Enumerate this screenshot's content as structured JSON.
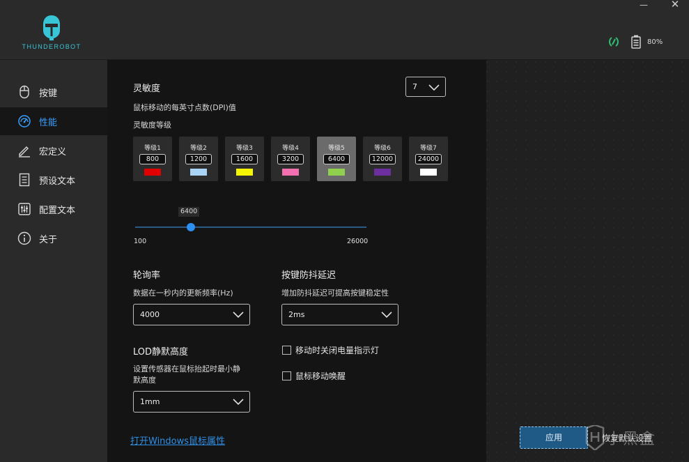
{
  "app": {
    "brand": "THUNDEROBOT",
    "battery": "80%",
    "window_min": "—",
    "window_close": "✕"
  },
  "sidebar": {
    "items": [
      {
        "label": "按键",
        "icon": "mouse-icon",
        "active": false
      },
      {
        "label": "性能",
        "icon": "gauge-icon",
        "active": true
      },
      {
        "label": "宏定义",
        "icon": "pen-icon",
        "active": false
      },
      {
        "label": "预设文本",
        "icon": "document-icon",
        "active": false
      },
      {
        "label": "配置文本",
        "icon": "sliders-icon",
        "active": false
      },
      {
        "label": "关于",
        "icon": "info-icon",
        "active": false
      }
    ]
  },
  "sensitivity": {
    "title": "灵敏度",
    "desc": "鼠标移动的每英寸点数(DPI)值",
    "levels_label": "灵敏度等级",
    "level_count": "7",
    "levels": [
      {
        "name": "等级1",
        "value": "800",
        "color": "#e00000"
      },
      {
        "name": "等级2",
        "value": "1200",
        "color": "#a9d4f5"
      },
      {
        "name": "等级3",
        "value": "1600",
        "color": "#f5f500"
      },
      {
        "name": "等级4",
        "value": "3200",
        "color": "#f36fb0"
      },
      {
        "name": "等级5",
        "value": "6400",
        "color": "#8fd14f"
      },
      {
        "name": "等级6",
        "value": "12000",
        "color": "#6b2fa0"
      },
      {
        "name": "等级7",
        "value": "24000",
        "color": "#ffffff"
      }
    ],
    "active_level": 5,
    "slider": {
      "value": "6400",
      "min": "100",
      "max": "26000",
      "fraction": 0.24
    }
  },
  "polling": {
    "title": "轮询率",
    "desc": "数据在一秒内的更新频率(Hz)",
    "value": "4000"
  },
  "debounce": {
    "title": "按键防抖延迟",
    "desc": "增加防抖延迟可提高按键稳定性",
    "value": "2ms"
  },
  "lod": {
    "title": "LOD静默高度",
    "desc_line1": "设置传感器在鼠标抬起时最小静",
    "desc_line2": "默高度",
    "value": "1mm"
  },
  "options": {
    "led_off_moving": "移动时关闭电量指示灯",
    "wake_on_move": "鼠标移动唤醒"
  },
  "footer": {
    "windows_link": "打开Windows鼠标属性",
    "apply": "应用",
    "reset": "恢复默认设置",
    "watermark": "小黑盒"
  },
  "colors": {
    "accent": "#3aa0ff",
    "brand": "#38c6d6",
    "connection": "#2fbf71"
  }
}
